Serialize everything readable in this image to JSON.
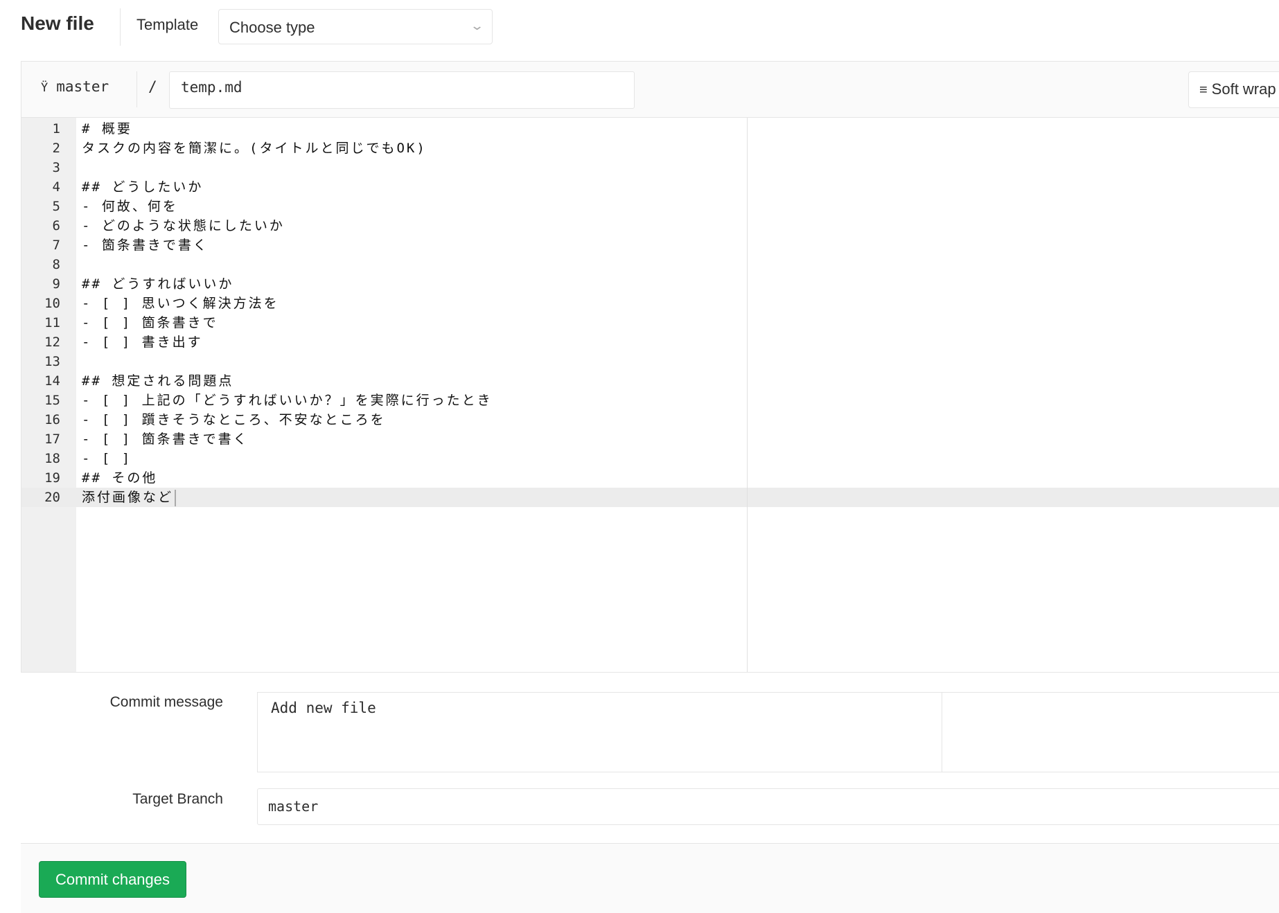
{
  "header": {
    "title": "New file",
    "template_label": "Template",
    "template_select": "Choose type"
  },
  "editor": {
    "branch": "master",
    "separator": "/",
    "filename": "temp.md",
    "soft_wrap_label": "Soft wrap",
    "active_line": 20,
    "lines": [
      "# 概要",
      "タスクの内容を簡潔に。(タイトルと同じでもOK)",
      "",
      "## どうしたいか",
      "- 何故、何を",
      "- どのような状態にしたいか",
      "- 箇条書きで書く",
      "",
      "## どうすればいいか",
      "- [ ] 思いつく解決方法を",
      "- [ ] 箇条書きで",
      "- [ ] 書き出す",
      "",
      "## 想定される問題点",
      "- [ ] 上記の「どうすればいいか？」を実際に行ったとき",
      "- [ ] 躓きそうなところ、不安なところを",
      "- [ ] 箇条書きで書く",
      "- [ ]",
      "## その他",
      "添付画像など"
    ]
  },
  "commit": {
    "message_label": "Commit message",
    "message_value": "Add new file",
    "branch_label": "Target Branch",
    "branch_value": "master",
    "submit_label": "Commit changes"
  },
  "colors": {
    "primary_button": "#1aaa55",
    "active_line": "#ececec",
    "gutter": "#f0f0f0"
  },
  "icons": {
    "branch": "git-branch-icon",
    "soft_wrap": "wrap-icon",
    "select": "chevron-down-icon"
  }
}
